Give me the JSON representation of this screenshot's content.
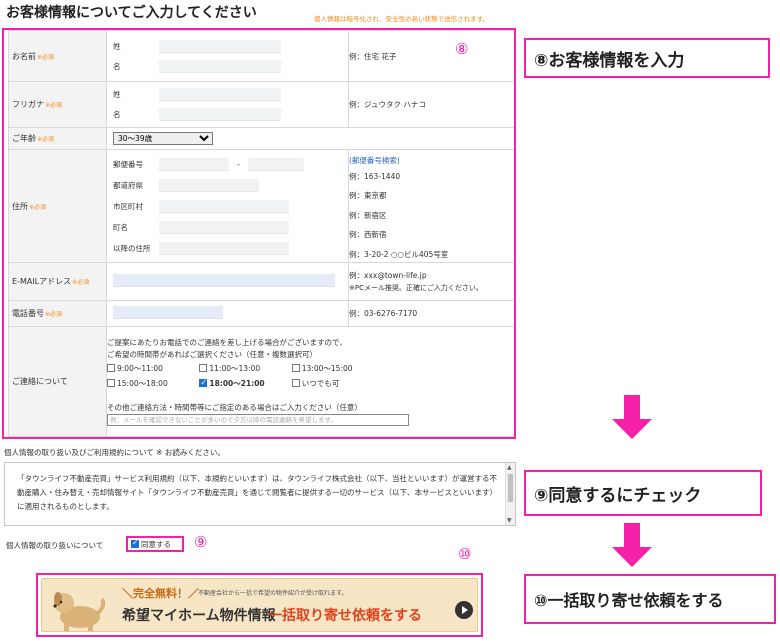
{
  "page": {
    "title": "お客様情報についてご入力してください",
    "note": "個人情報は暗号化され、安全性の高い状態で送信されます。"
  },
  "required": "※必須",
  "form": {
    "name": {
      "label": "お名前",
      "sei": "姓",
      "mei": "名",
      "example": "例：住宅 花子"
    },
    "kana": {
      "label": "フリガナ",
      "sei": "姓",
      "mei": "名",
      "example": "例：ジュウタク ハナコ"
    },
    "age": {
      "label": "ご年齢",
      "selected": "30～39歳"
    },
    "address": {
      "label": "住所",
      "rows": [
        {
          "label": "郵便番号",
          "example": "例：163-1440"
        },
        {
          "label": "都道府県",
          "example": "例：東京都"
        },
        {
          "label": "市区町村",
          "example": "例：新宿区"
        },
        {
          "label": "町名",
          "example": "例：西新宿"
        },
        {
          "label": "以降の住所",
          "example": "例：3-20-2 ○○ビル405号室"
        }
      ],
      "lookup_link": "(郵便番号検索)",
      "postal_dash": "-"
    },
    "email": {
      "label": "E-MAILアドレス",
      "example1": "例：xxx@town-life.jp",
      "example2": "※PCメール推奨。正確にご入力ください。"
    },
    "phone": {
      "label": "電話番号",
      "example": "例：03-6276-7170"
    },
    "contact": {
      "label": "ご連絡について",
      "line1": "ご提案にあたりお電話でのご連絡を差し上げる場合がございますので、",
      "line2": "ご希望の時間帯があればご選択ください（任意・複数選択可）",
      "slots": [
        {
          "label": "9:00～11:00",
          "checked": false
        },
        {
          "label": "11:00～13:00",
          "checked": false
        },
        {
          "label": "13:00～15:00",
          "checked": false
        },
        {
          "label": "15:00～18:00",
          "checked": false
        },
        {
          "label": "18:00～21:00",
          "checked": true
        },
        {
          "label": "いつでも可",
          "checked": false
        }
      ],
      "memo_label": "その他ご連絡方法・時間帯等にご指定のある場合はご入力ください（任意）",
      "memo_placeholder": "例：メールを確認できないことが多いので夕方以降の電話連絡を希望します。"
    }
  },
  "privacy": {
    "heading": "個人情報の取り扱い及びご利用規約について ※ お読みください。",
    "terms_text": "「タウンライフ不動産売買」サービス利用規約（以下、本規約といいます）は、タウンライフ株式会社（以下、当社といいます）が運営する不動産購入・住み替え・売却情報サイト「タウンライフ不動産売買」を通じて閲覧者に提供する一切のサービス（以下、本サービスといいます）に適用されるものとします。",
    "agree_label": "個人情報の取り扱いについて",
    "agree_checkbox": "同意する",
    "agree_checked": true
  },
  "banner": {
    "line1": "＼完全無料！／",
    "line1_sub": "不動産会社から一括で希望の物件紹介が受け取れます。",
    "line2a": "希望マイホーム物件情報",
    "line2b": "一括取り寄せ依頼をする"
  },
  "annotations": {
    "mark8": "⑧",
    "mark9": "⑨",
    "mark10": "⑩",
    "callout8": "⑧お客様情報を入力",
    "callout9": "⑨同意するにチェック",
    "callout10": "⑩一括取り寄せ依頼をする"
  },
  "colors": {
    "accent": "#f51fa8",
    "required": "#f08c1a",
    "link": "#2a66c4",
    "banner_bg": "#f7e6c6"
  }
}
